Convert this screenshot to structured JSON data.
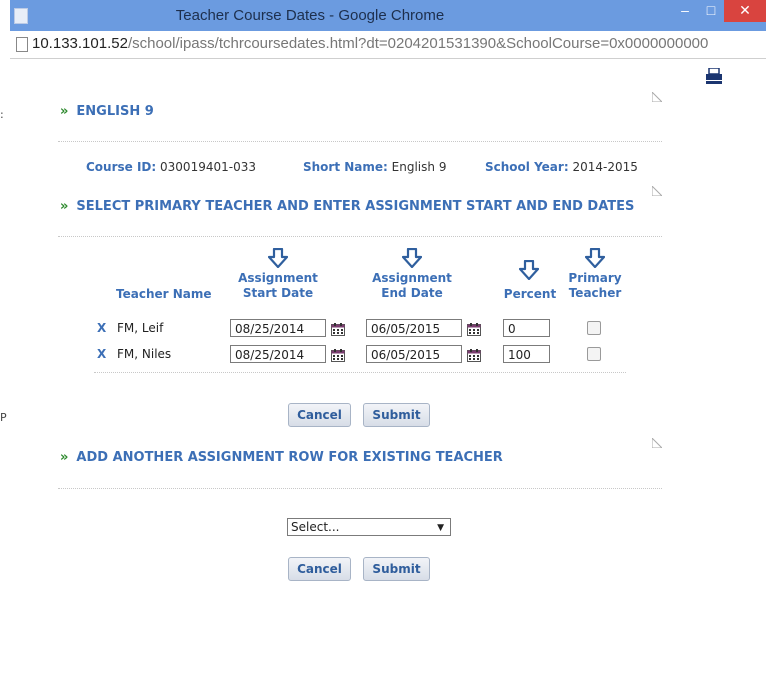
{
  "window": {
    "title": "Teacher Course Dates - Google Chrome",
    "url_host": "10.133.101.52",
    "url_path": "/school/ipass/tchrcoursedates.html?dt=0204201531390&SchoolCourse=0x0000000000"
  },
  "left_strip": {
    "fragment_1": ":",
    "fragment_2": "P"
  },
  "course": {
    "heading": "ENGLISH 9",
    "course_id_label": "Course ID:",
    "course_id_value": "030019401-033",
    "short_name_label": "Short Name:",
    "short_name_value": "English 9",
    "school_year_label": "School Year:",
    "school_year_value": "2014-2015"
  },
  "primary_section": {
    "heading": "SELECT PRIMARY TEACHER AND ENTER ASSIGNMENT START AND END DATES"
  },
  "table": {
    "headers": {
      "teacher_name": "Teacher Name",
      "start_1": "Assignment",
      "start_2": "Start Date",
      "end_1": "Assignment",
      "end_2": "End Date",
      "percent": "Percent",
      "primary_1": "Primary",
      "primary_2": "Teacher"
    },
    "rows": [
      {
        "remove": "X",
        "name": "FM, Leif",
        "start": "08/25/2014",
        "end": "06/05/2015",
        "percent": "0",
        "primary": false
      },
      {
        "remove": "X",
        "name": "FM, Niles",
        "start": "08/25/2014",
        "end": "06/05/2015",
        "percent": "100",
        "primary": false
      }
    ]
  },
  "buttons": {
    "cancel": "Cancel",
    "submit": "Submit"
  },
  "add_section": {
    "heading": "ADD ANOTHER ASSIGNMENT ROW FOR EXISTING TEACHER",
    "select_value": "Select..."
  },
  "colors": {
    "titlebar": "#6b9be0",
    "close_button": "#d9443f",
    "heading_blue": "#3c6fb6",
    "chevron_green": "#2f8a2f"
  },
  "icons": {
    "printer": "printer-icon",
    "calendar": "calendar-icon",
    "arrow": "down-arrow-icon",
    "chevron": "double-chevron-icon"
  }
}
